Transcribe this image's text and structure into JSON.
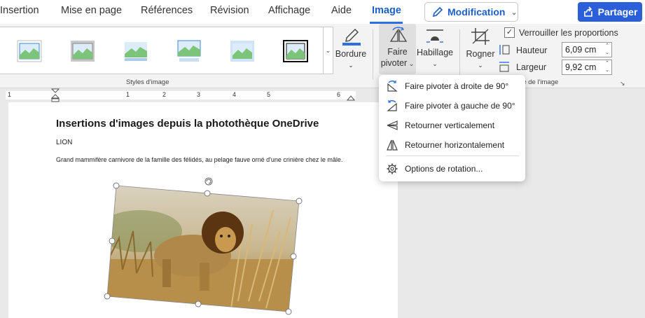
{
  "tabs": [
    {
      "label": "Insertion"
    },
    {
      "label": "Mise en page"
    },
    {
      "label": "Références"
    },
    {
      "label": "Révision"
    },
    {
      "label": "Affichage"
    },
    {
      "label": "Aide"
    },
    {
      "label": "Image"
    }
  ],
  "active_tab": "Image",
  "modification_button": {
    "label": "Modification"
  },
  "share_button": {
    "label": "Partager"
  },
  "ribbon": {
    "styles_group_label": "Styles d'image",
    "bordure_label": "Bordure",
    "faire_pivoter_line1": "Faire",
    "faire_pivoter_line2": "pivoter",
    "habillage_label": "Habillage",
    "rogner_label": "Rogner",
    "lock_ratio_label": "Verrouiller les proportions",
    "lock_ratio_checked": true,
    "hauteur_label": "Hauteur",
    "hauteur_value": "6,09 cm",
    "largeur_label": "Largeur",
    "largeur_value": "9,92 cm",
    "size_group_label": "ille de l'image"
  },
  "ruler": {
    "numbers": [
      "1",
      "1",
      "2",
      "3",
      "4",
      "5",
      "6"
    ]
  },
  "document": {
    "title": "Insertions d'images depuis la photothèque OneDrive",
    "subtitle": "LION",
    "paragraph": "Grand mammifère carnivore de la famille des félidés, au pelage fauve orné d'une crinière chez le mâle."
  },
  "rotate_menu": {
    "items": [
      {
        "label": "Faire pivoter à droite de 90°",
        "icon": "rotate-right-icon"
      },
      {
        "label": "Faire pivoter à gauche de 90°",
        "icon": "rotate-left-icon"
      },
      {
        "label": "Retourner verticalement",
        "icon": "flip-vertical-icon"
      },
      {
        "label": "Retourner horizontalement",
        "icon": "flip-horizontal-icon"
      },
      {
        "label": "Options de rotation...",
        "icon": "gear-icon"
      }
    ]
  },
  "colors": {
    "accent": "#2b6fe0",
    "share_bg": "#2b5fd8",
    "tab_active": "#1d5fc9"
  }
}
